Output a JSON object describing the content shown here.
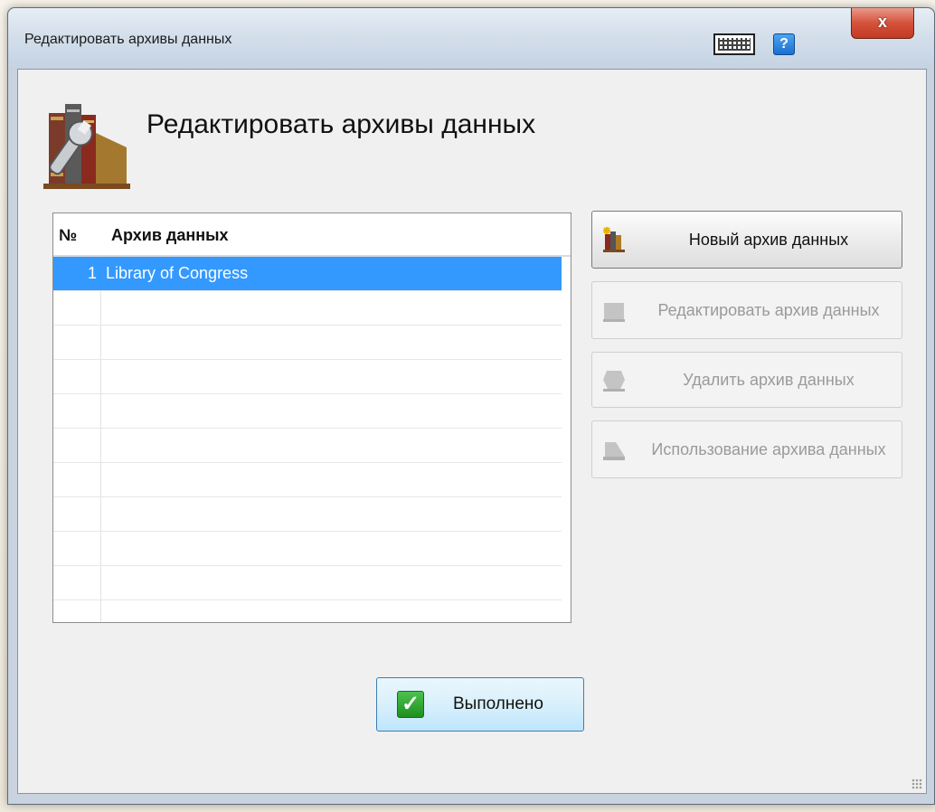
{
  "window": {
    "title": "Редактировать архивы данных",
    "close_label": "x",
    "help_label": "?"
  },
  "header": {
    "title": "Редактировать архивы данных"
  },
  "list": {
    "columns": {
      "num": "№",
      "name": "Архив данных"
    },
    "rows": [
      {
        "num": "1",
        "name": "Library of Congress",
        "selected": true
      },
      {
        "num": "",
        "name": ""
      },
      {
        "num": "",
        "name": ""
      },
      {
        "num": "",
        "name": ""
      },
      {
        "num": "",
        "name": ""
      },
      {
        "num": "",
        "name": ""
      },
      {
        "num": "",
        "name": ""
      },
      {
        "num": "",
        "name": ""
      },
      {
        "num": "",
        "name": ""
      },
      {
        "num": "",
        "name": ""
      }
    ]
  },
  "buttons": {
    "new_archive": "Новый архив данных",
    "edit_archive": "Редактировать архив данных",
    "delete_archive": "Удалить архив данных",
    "archive_usage": "Использование архива данных",
    "done": "Выполнено"
  },
  "colors": {
    "selection": "#3399ff",
    "disabled_text": "#9a9a9a",
    "done_check": "#2ea82e"
  }
}
